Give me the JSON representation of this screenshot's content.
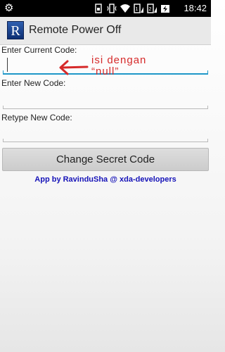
{
  "status_bar": {
    "time": "18:42",
    "icons": [
      "settings-icon",
      "sim-icon",
      "vibrate-icon",
      "wifi-icon",
      "sim-signal-icon",
      "cell-signal-icon",
      "battery-charging-icon"
    ]
  },
  "action_bar": {
    "title": "Remote Power Off",
    "app_icon_letter": "R"
  },
  "form": {
    "current_label": "Enter Current Code:",
    "current_value": "",
    "new_label": "Enter New Code:",
    "new_value": "",
    "retype_label": "Retype New Code:",
    "retype_value": "",
    "button_label": "Change Secret Code"
  },
  "credit": "App by RavinduSha @ xda-developers",
  "annotation": {
    "line1": "isi dengan",
    "line2": "“null”"
  },
  "colors": {
    "focus": "#1e97c8",
    "credit": "#1512b8",
    "annotation": "#d62a2a"
  }
}
